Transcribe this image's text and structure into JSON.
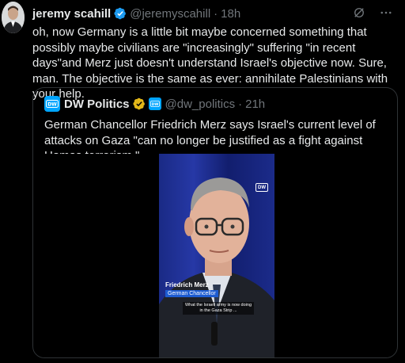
{
  "tweet": {
    "author_name": "jeremy scahill",
    "handle": "@jeremyscahill",
    "dot": "·",
    "time": "18h",
    "text": "oh, now Germany is a little bit maybe concerned something that possibly maybe civilians are \"increasingly\" suffering \"in recent days\"and Merz just doesn't understand Israel's objective now. Sure, man. The objective is the same as ever: annihilate Palestinians with your help."
  },
  "quoted": {
    "author_name": "DW Politics",
    "handle": "@dw_politics",
    "dot": "·",
    "time": "21h",
    "text": "German Chancellor Friedrich Merz says Israel's current level of attacks on Gaza \"can no longer be justified as a fight against Hamas terrorism.\"",
    "video": {
      "caption_name": "Friedrich Merz",
      "caption_role": "German Chancellor",
      "subtitle": "What the Israeli army is now doing in the Gaza Strip ...",
      "watermark": "DW"
    }
  },
  "colors": {
    "accent": "#1d9bf0",
    "verified_gold": "#e2b719",
    "dw_blue": "#00a5ff",
    "muted_text": "#71767b"
  }
}
